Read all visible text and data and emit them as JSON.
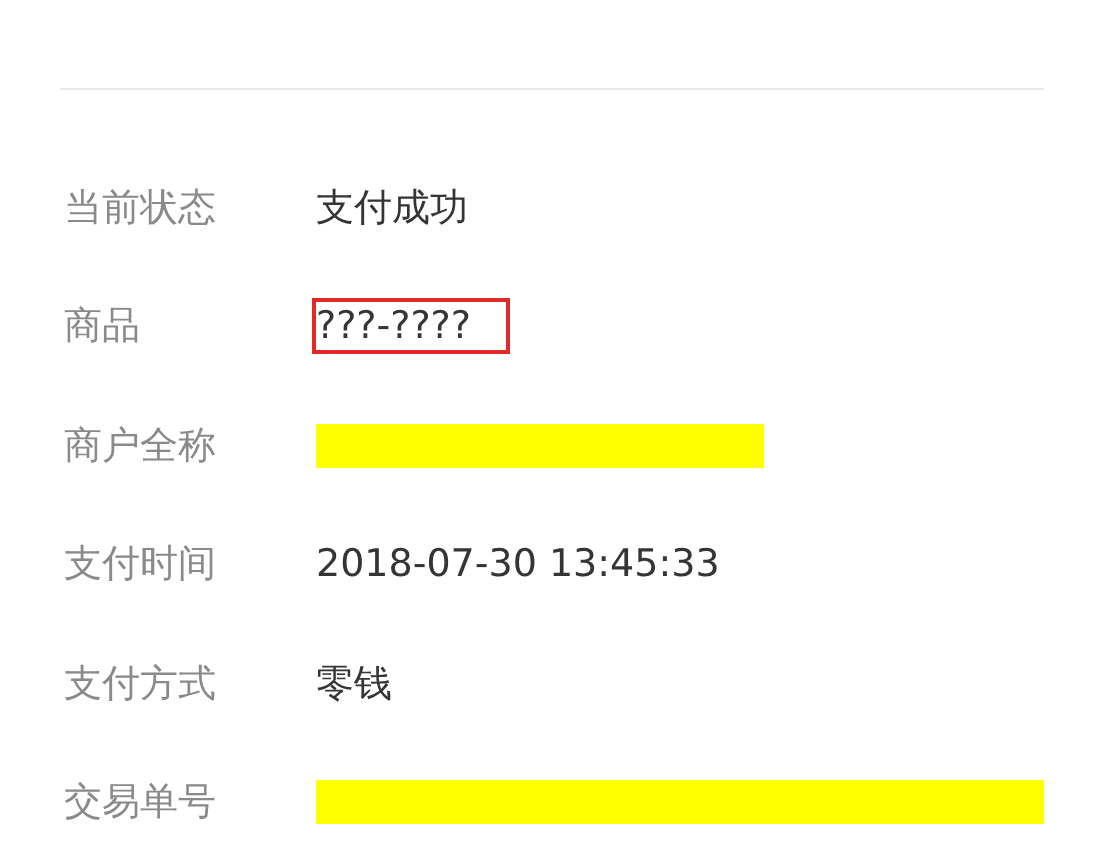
{
  "rows": [
    {
      "label": "当前状态",
      "kind": "text",
      "value": "支付成功"
    },
    {
      "label": "商品",
      "kind": "boxed",
      "value": "???-????"
    },
    {
      "label": "商户全称",
      "kind": "redacted_short"
    },
    {
      "label": "支付时间",
      "kind": "text",
      "value": "2018-07-30 13:45:33"
    },
    {
      "label": "支付方式",
      "kind": "text",
      "value": "零钱"
    },
    {
      "label": "交易单号",
      "kind": "redacted_long"
    }
  ]
}
